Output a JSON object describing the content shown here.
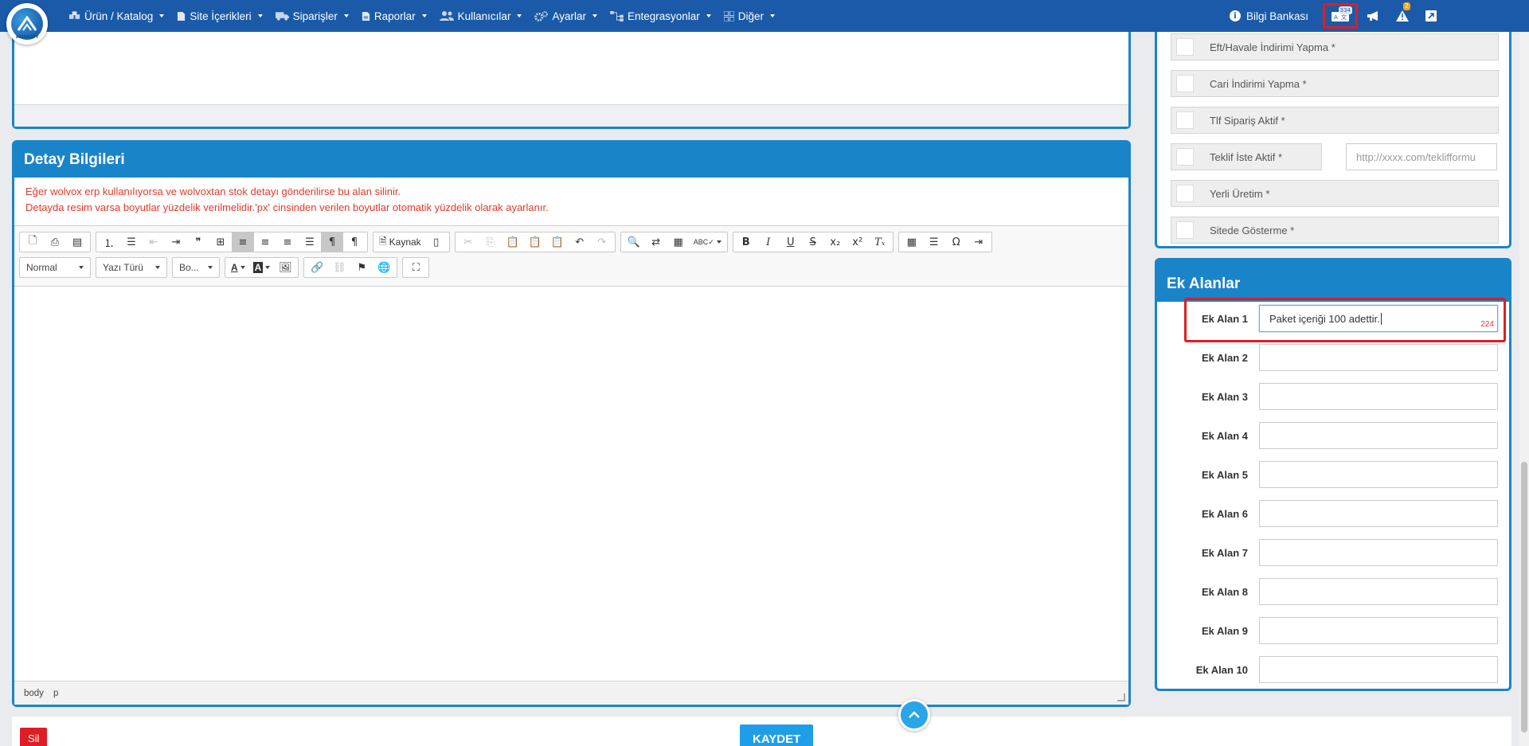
{
  "nav": {
    "logo_text": "AKINSOFT",
    "menu": [
      {
        "label": "Ürün / Katalog",
        "icon": "cubes-icon"
      },
      {
        "label": "Site İçerikleri",
        "icon": "file-icon"
      },
      {
        "label": "Siparişler",
        "icon": "truck-icon"
      },
      {
        "label": "Raporlar",
        "icon": "report-icon"
      },
      {
        "label": "Kullanıcılar",
        "icon": "users-icon"
      },
      {
        "label": "Ayarlar",
        "icon": "cogs-icon"
      },
      {
        "label": "Entegrasyonlar",
        "icon": "sitemap-icon"
      },
      {
        "label": "Diğer",
        "icon": "grid-icon"
      }
    ],
    "knowledge_base": "Bilgi Bankası",
    "tool_badge_small": "334",
    "alert_badge": "2"
  },
  "detay": {
    "title": "Detay Bilgileri",
    "warning_line1": "Eğer wolvox erp kullanılıyorsa ve wolvoxtan stok detayı gönderilirse bu alan silinir.",
    "warning_line2": "Detayda resim varsa boyutlar yüzdelik verilmelidir.'px' cinsinden verilen boyutlar otomatik yüzdelik olarak ayarlanır.",
    "toolbar": {
      "source_label": "Kaynak",
      "format_combo": "Normal",
      "font_combo": "Yazı Türü",
      "size_combo": "Bo..."
    },
    "path": [
      "body",
      "p"
    ]
  },
  "checkboxes": [
    {
      "label": "Eft/Havale İndirimi Yapma *"
    },
    {
      "label": "Cari İndirimi Yapma *"
    },
    {
      "label": "Tlf Sipariş Aktif *"
    },
    {
      "label": "Teklif İste Aktif *",
      "placeholder": "http://xxxx.com/teklifformu"
    },
    {
      "label": "Yerli Üretim *"
    },
    {
      "label": "Sitede Gösterme *"
    }
  ],
  "ek_alanlar": {
    "title": "Ek Alanlar",
    "fields": [
      {
        "label": "Ek Alan 1",
        "value": "Paket içeriği 100 adettir.",
        "counter": "224"
      },
      {
        "label": "Ek Alan 2",
        "value": ""
      },
      {
        "label": "Ek Alan 3",
        "value": ""
      },
      {
        "label": "Ek Alan 4",
        "value": ""
      },
      {
        "label": "Ek Alan 5",
        "value": ""
      },
      {
        "label": "Ek Alan 6",
        "value": ""
      },
      {
        "label": "Ek Alan 7",
        "value": ""
      },
      {
        "label": "Ek Alan 8",
        "value": ""
      },
      {
        "label": "Ek Alan 9",
        "value": ""
      },
      {
        "label": "Ek Alan 10",
        "value": ""
      }
    ]
  },
  "actions": {
    "delete": "Sil",
    "save": "KAYDET"
  },
  "colors": {
    "nav": "#1a5aa8",
    "panel": "#1a84c9",
    "danger": "#e01c24",
    "primary": "#1e9ee8"
  }
}
